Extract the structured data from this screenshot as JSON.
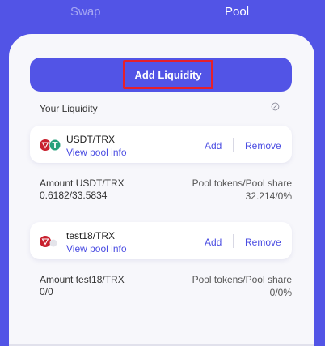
{
  "tabs": {
    "swap": "Swap",
    "pool": "Pool"
  },
  "add_liquidity_label": "Add Liquidity",
  "your_liquidity": "Your Liquidity",
  "pools": [
    {
      "pair": "USDT/TRX",
      "view_info": "View pool info",
      "add": "Add",
      "remove": "Remove",
      "amount_label": "Amount  USDT/TRX",
      "amount_value": "0.6182/33.5834",
      "share_label": "Pool tokens/Pool share",
      "share_value": "32.214/0%"
    },
    {
      "pair": "test18/TRX",
      "view_info": "View pool info",
      "add": "Add",
      "remove": "Remove",
      "amount_label": "Amount  test18/TRX",
      "amount_value": "0/0",
      "share_label": "Pool tokens/Pool share",
      "share_value": "0/0%"
    }
  ],
  "colors": {
    "brand": "#5254e6",
    "link": "#4a4ce2",
    "highlight": "#e6202a",
    "trx": "#c8202e",
    "usdt": "#26a17b"
  }
}
